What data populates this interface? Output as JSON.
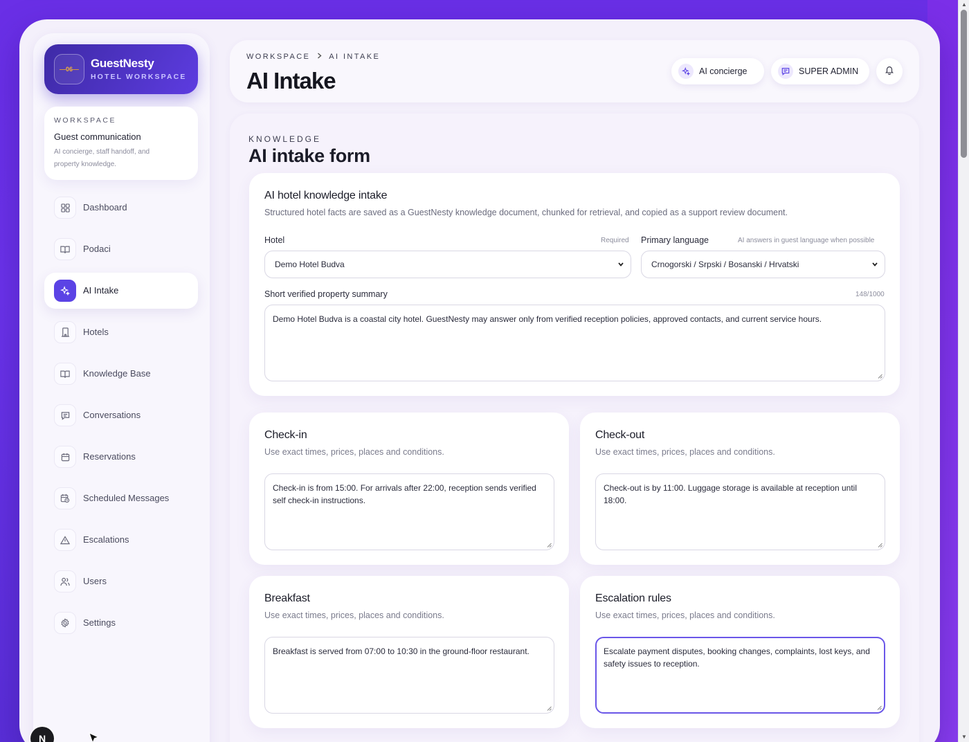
{
  "brand": {
    "logo_text": "06",
    "name": "GuestNesty",
    "subtitle": "HOTEL WORKSPACE"
  },
  "workspace_card": {
    "eyebrow": "WORKSPACE",
    "title": "Guest communication",
    "description": "AI concierge, staff handoff, and property knowledge."
  },
  "sidebar": {
    "items": [
      {
        "label": "Dashboard",
        "icon": "grid-icon",
        "active": false
      },
      {
        "label": "Podaci",
        "icon": "book-icon",
        "active": false
      },
      {
        "label": "AI Intake",
        "icon": "sparkle-icon",
        "active": true
      },
      {
        "label": "Hotels",
        "icon": "building-icon",
        "active": false
      },
      {
        "label": "Knowledge Base",
        "icon": "book-icon",
        "active": false
      },
      {
        "label": "Conversations",
        "icon": "chat-icon",
        "active": false
      },
      {
        "label": "Reservations",
        "icon": "calendar-icon",
        "active": false
      },
      {
        "label": "Scheduled Messages",
        "icon": "calendar-clock-icon",
        "active": false
      },
      {
        "label": "Escalations",
        "icon": "warning-icon",
        "active": false
      },
      {
        "label": "Users",
        "icon": "users-icon",
        "active": false
      },
      {
        "label": "Settings",
        "icon": "gear-icon",
        "active": false
      }
    ]
  },
  "dev_badge": "N",
  "header": {
    "breadcrumb": [
      "WORKSPACE",
      "AI INTAKE"
    ],
    "title": "AI Intake",
    "ai_concierge_label": "AI concierge",
    "role_label": "SUPER ADMIN"
  },
  "main": {
    "eyebrow": "KNOWLEDGE",
    "title": "AI intake form",
    "intake": {
      "title": "AI hotel knowledge intake",
      "description": "Structured hotel facts are saved as a GuestNesty knowledge document, chunked for retrieval, and copied as a support review document.",
      "hotel_label": "Hotel",
      "hotel_hint": "Required",
      "hotel_value": "Demo Hotel Budva",
      "language_label": "Primary language",
      "language_hint": "AI answers in guest language when possible",
      "language_value": "Crnogorski / Srpski / Bosanski / Hrvatski",
      "summary_label": "Short verified property summary",
      "summary_count": "148/1000",
      "summary_value": "Demo Hotel Budva is a coastal city hotel. GuestNesty may answer only from verified reception policies, approved contacts, and current service hours."
    },
    "sections": [
      {
        "title": "Check-in",
        "description": "Use exact times, prices, places and conditions.",
        "value": "Check-in is from 15:00. For arrivals after 22:00, reception sends verified self check-in instructions."
      },
      {
        "title": "Check-out",
        "description": "Use exact times, prices, places and conditions.",
        "value": "Check-out is by 11:00. Luggage storage is available at reception until 18:00."
      },
      {
        "title": "Breakfast",
        "description": "Use exact times, prices, places and conditions.",
        "value": "Breakfast is served from 07:00 to 10:30 in the ground-floor restaurant."
      },
      {
        "title": "Escalation rules",
        "description": "Use exact times, prices, places and conditions.",
        "value": "Escalate payment disputes, booking changes, complaints, lost keys, and safety issues to reception."
      }
    ]
  },
  "colors": {
    "accent": "#5b43e5",
    "brand_gradient_start": "#3e2aa6",
    "brand_gradient_end": "#5d3ce0",
    "page_bg": "#6a2fe6"
  }
}
